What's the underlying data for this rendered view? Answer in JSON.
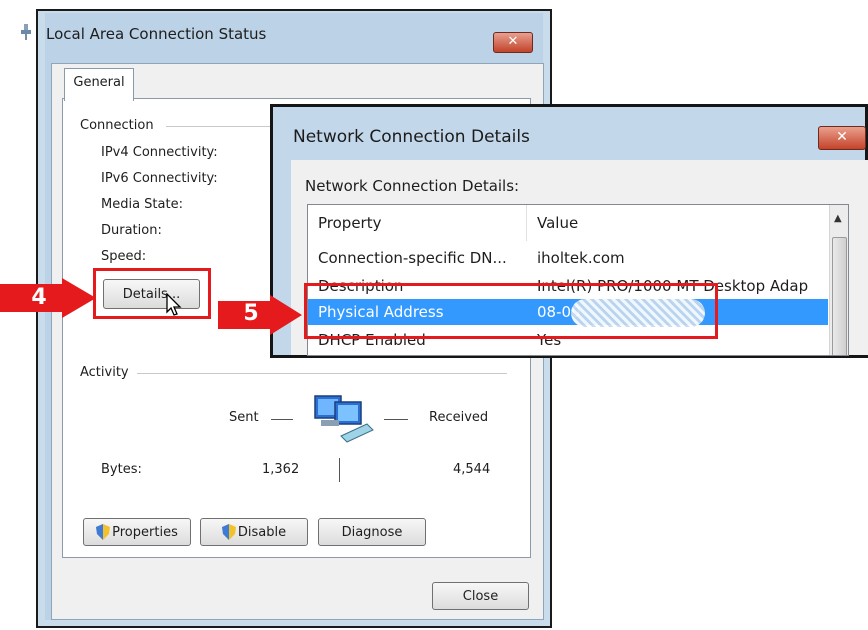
{
  "status_window": {
    "title": "Local Area Connection Status",
    "close_label": "✕",
    "tab_general": "General",
    "connection_group": "Connection",
    "fields": {
      "ipv4": "IPv4 Connectivity:",
      "ipv6": "IPv6 Connectivity:",
      "media_state": "Media State:",
      "duration": "Duration:",
      "speed": "Speed:"
    },
    "details_button": "Details...",
    "activity_group": "Activity",
    "sent_label": "Sent",
    "received_label": "Received",
    "bytes_label": "Bytes:",
    "bytes_sent": "1,362",
    "bytes_received": "4,544",
    "properties_button": "Properties",
    "disable_button": "Disable",
    "diagnose_button": "Diagnose",
    "close_button": "Close"
  },
  "details_window": {
    "title": "Network Connection Details",
    "close_label": "✕",
    "subtitle": "Network Connection Details:",
    "columns": [
      "Property",
      "Value"
    ],
    "rows": [
      {
        "property": "Connection-specific DN...",
        "value": "iholtek.com"
      },
      {
        "property": "Description",
        "value": "Intel(R) PRO/1000 MT Desktop Adap"
      },
      {
        "property": "Physical Address",
        "value": "08-00"
      },
      {
        "property": "DHCP Enabled",
        "value": "Yes"
      }
    ],
    "selected_row": 2
  },
  "annotations": {
    "step4": "4",
    "step5": "5",
    "accent_color": "#e41a1c"
  },
  "icons": [
    "network-status-icon",
    "network-computers-icon",
    "shield-icon",
    "cursor-icon",
    "arrow-icon"
  ]
}
